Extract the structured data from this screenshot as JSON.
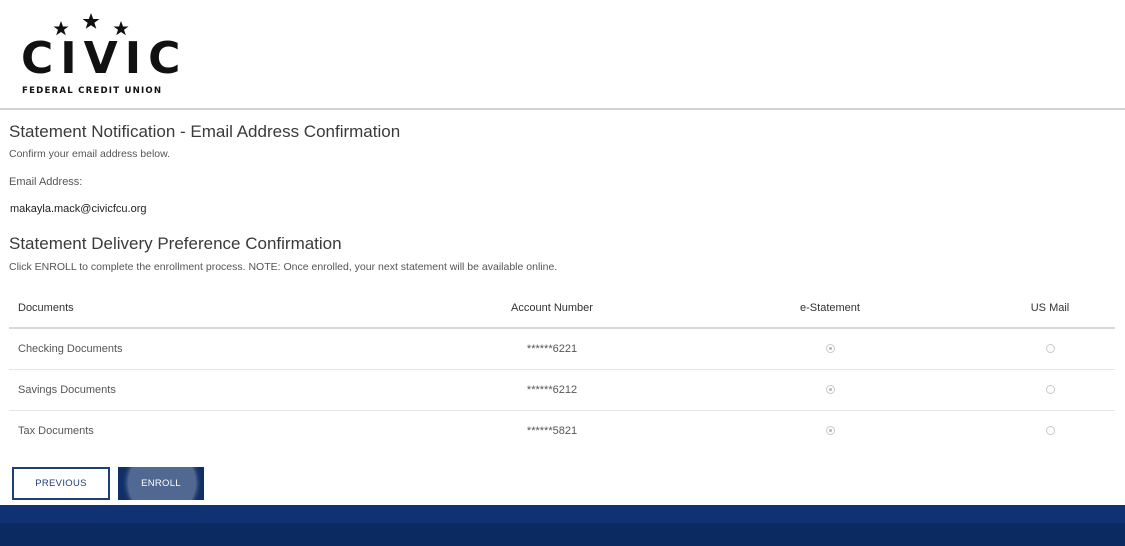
{
  "brand": {
    "name": "CIVIC",
    "subtitle": "FEDERAL CREDIT UNION",
    "icon": "three-stars-icon"
  },
  "email_section": {
    "title": "Statement Notification - Email Address Confirmation",
    "instruction": "Confirm your email address below.",
    "label": "Email Address:",
    "value": "makayla.mack@civicfcu.org"
  },
  "delivery_section": {
    "title": "Statement Delivery Preference Confirmation",
    "instruction": "Click ENROLL to complete the enrollment process. NOTE: Once enrolled, your next statement will be available online."
  },
  "table": {
    "headers": [
      "Documents",
      "Account Number",
      "e-Statement",
      "US Mail"
    ],
    "rows": [
      {
        "document": "Checking Documents",
        "account": "******6221",
        "e_statement": true,
        "us_mail": false
      },
      {
        "document": "Savings Documents",
        "account": "******6212",
        "e_statement": true,
        "us_mail": false
      },
      {
        "document": "Tax Documents",
        "account": "******5821",
        "e_statement": true,
        "us_mail": false
      }
    ]
  },
  "buttons": {
    "previous": "PREVIOUS",
    "enroll": "ENROLL"
  },
  "colors": {
    "primary_navy": "#0f2f68",
    "footer": "#0c2a62"
  }
}
